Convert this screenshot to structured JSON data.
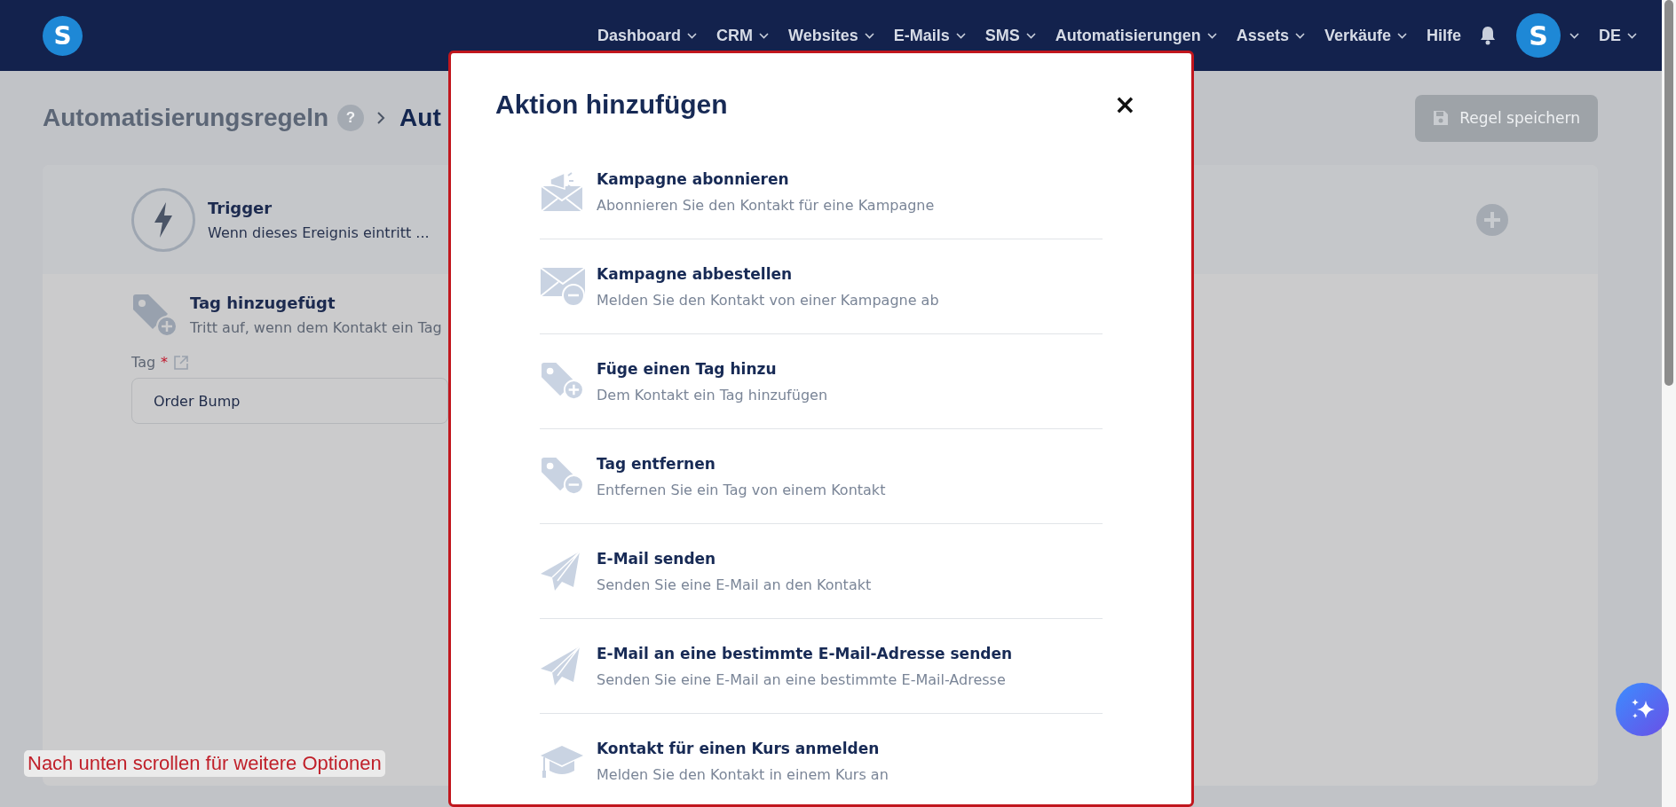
{
  "nav": {
    "logo": "S",
    "items": [
      {
        "label": "Dashboard",
        "dropdown": true
      },
      {
        "label": "CRM",
        "dropdown": true
      },
      {
        "label": "Websites",
        "dropdown": true
      },
      {
        "label": "E-Mails",
        "dropdown": true
      },
      {
        "label": "SMS",
        "dropdown": true
      },
      {
        "label": "Automatisierungen",
        "dropdown": true
      },
      {
        "label": "Assets",
        "dropdown": true
      },
      {
        "label": "Verkäufe",
        "dropdown": true
      },
      {
        "label": "Hilfe",
        "dropdown": false
      }
    ],
    "avatar": "S",
    "language": "DE"
  },
  "breadcrumb": {
    "parent": "Automatisierungsregeln",
    "help": "?",
    "current": "Aut"
  },
  "save_button": "Regel speichern",
  "trigger": {
    "title": "Trigger",
    "subtitle": "Wenn dieses Ereignis eintritt ..."
  },
  "event": {
    "title": "Tag hinzugefügt",
    "description": "Tritt auf, wenn dem Kontakt ein Tag",
    "field_label": "Tag",
    "required_mark": "*",
    "field_value": "Order Bump"
  },
  "modal": {
    "title": "Aktion hinzufügen",
    "close": "×",
    "actions": [
      {
        "kind": "subscribe",
        "title": "Kampagne abonnieren",
        "description": "Abonnieren Sie den Kontakt für eine Kampagne"
      },
      {
        "kind": "unsubscribe",
        "title": "Kampagne abbestellen",
        "description": "Melden Sie den Kontakt von einer Kampagne ab"
      },
      {
        "kind": "tag-add",
        "title": "Füge einen Tag hinzu",
        "description": "Dem Kontakt ein Tag hinzufügen"
      },
      {
        "kind": "tag-remove",
        "title": "Tag entfernen",
        "description": "Entfernen Sie ein Tag von einem Kontakt"
      },
      {
        "kind": "email",
        "title": "E-Mail senden",
        "description": "Senden Sie eine E-Mail an den Kontakt"
      },
      {
        "kind": "email",
        "title": "E-Mail an eine bestimmte E-Mail-Adresse senden",
        "description": "Senden Sie eine E-Mail an eine bestimmte E-Mail-Adresse"
      },
      {
        "kind": "course",
        "title": "Kontakt für einen Kurs anmelden",
        "description": "Melden Sie den Kontakt in einem Kurs an"
      }
    ]
  },
  "scroll_hint": "Nach unten scrollen für weitere Optionen"
}
